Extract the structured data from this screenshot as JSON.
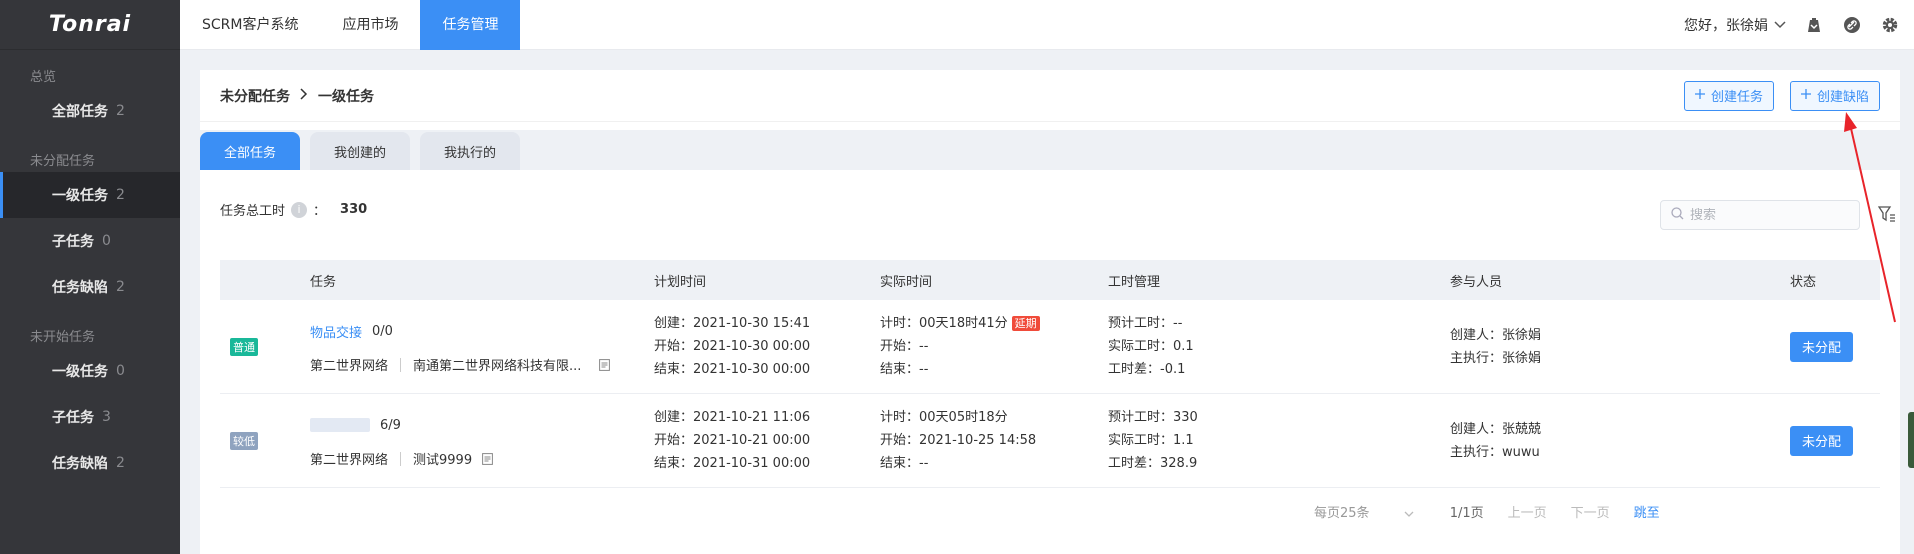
{
  "logo": "Tonrai",
  "sidebar": {
    "groups": [
      {
        "title": "总览",
        "items": [
          {
            "label": "全部任务",
            "count": "2"
          }
        ]
      },
      {
        "title": "未分配任务",
        "items": [
          {
            "label": "一级任务",
            "count": "2"
          },
          {
            "label": "子任务",
            "count": "0"
          },
          {
            "label": "任务缺陷",
            "count": "2"
          }
        ]
      },
      {
        "title": "未开始任务",
        "items": [
          {
            "label": "一级任务",
            "count": "0"
          },
          {
            "label": "子任务",
            "count": "3"
          },
          {
            "label": "任务缺陷",
            "count": "2"
          }
        ]
      }
    ]
  },
  "topbar": {
    "tabs": [
      {
        "label": "SCRM客户系统"
      },
      {
        "label": "应用市场"
      },
      {
        "label": "任务管理"
      }
    ],
    "greeting": "您好，张徐娟"
  },
  "breadcrumb": {
    "parent": "未分配任务",
    "current": "一级任务"
  },
  "actions": {
    "create_task": "创建任务",
    "create_defect": "创建缺陷"
  },
  "subtabs": [
    {
      "label": "全部任务"
    },
    {
      "label": "我创建的"
    },
    {
      "label": "我执行的"
    }
  ],
  "summary": {
    "label": "任务总工时",
    "colon": "：",
    "value": "330"
  },
  "search": {
    "placeholder": "搜索"
  },
  "table": {
    "headers": {
      "task": "任务",
      "plan": "计划时间",
      "actual": "实际时间",
      "hours": "工时管理",
      "people": "参与人员",
      "status": "状态"
    },
    "rows": [
      {
        "priority": "普通",
        "priority_color": "#19b899",
        "name": "物品交接",
        "progress": "0/0",
        "project": "第二世界网络",
        "company": "南通第二世界网络科技有限...",
        "plan": [
          "创建：2021-10-30 15:41",
          "开始：2021-10-30 00:00",
          "结束：2021-10-30 00:00"
        ],
        "actual_timer": "计时：00天18时41分",
        "actual_flag": "延期",
        "actual": [
          "开始：--",
          "结束：--"
        ],
        "hours": [
          "预计工时：--",
          "实际工时：0.1",
          "工时差：-0.1"
        ],
        "people": [
          "创建人：张徐娟",
          "主执行：张徐娟"
        ],
        "status": "未分配"
      },
      {
        "priority": "较低",
        "priority_color": "#8fa3bf",
        "name": "",
        "progress": "6/9",
        "project": "第二世界网络",
        "company": "测试9999",
        "plan": [
          "创建：2021-10-21 11:06",
          "开始：2021-10-21 00:00",
          "结束：2021-10-31 00:00"
        ],
        "actual_timer": "计时：00天05时18分",
        "actual_flag": "",
        "actual": [
          "开始：2021-10-25 14:58",
          "结束：--"
        ],
        "hours": [
          "预计工时：330",
          "实际工时：1.1",
          "工时差：328.9"
        ],
        "people": [
          "创建人：张兢兢",
          "主执行：wuwu"
        ],
        "status": "未分配"
      }
    ]
  },
  "pager": {
    "page_size": "每页25条",
    "pages": "1/1页",
    "prev": "上一页",
    "next": "下一页",
    "jump": "跳至"
  },
  "colors": {
    "primary": "#3b8ff5",
    "sidebar_bg": "#35363a",
    "delay": "#f04b3a"
  }
}
